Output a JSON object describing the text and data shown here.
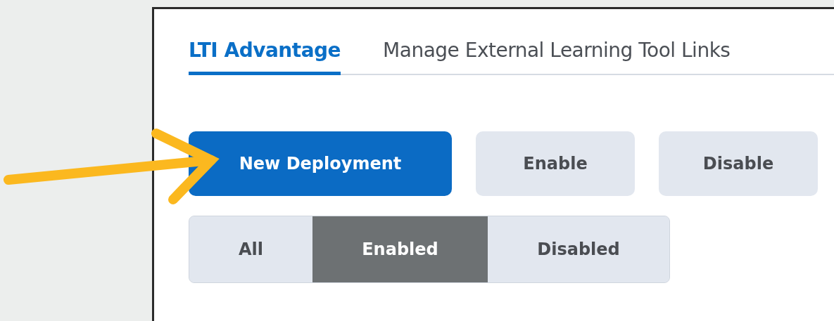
{
  "tabs": [
    {
      "label": "LTI Advantage",
      "selected": true
    },
    {
      "label": "Manage External Learning Tool Links",
      "selected": false
    }
  ],
  "actions": [
    {
      "label": "New Deployment",
      "kind": "primary"
    },
    {
      "label": "Enable",
      "kind": "secondary"
    },
    {
      "label": "Disable",
      "kind": "secondary"
    }
  ],
  "filters": [
    {
      "label": "All",
      "selected": false
    },
    {
      "label": "Enabled",
      "selected": true
    },
    {
      "label": "Disabled",
      "selected": false
    }
  ]
}
